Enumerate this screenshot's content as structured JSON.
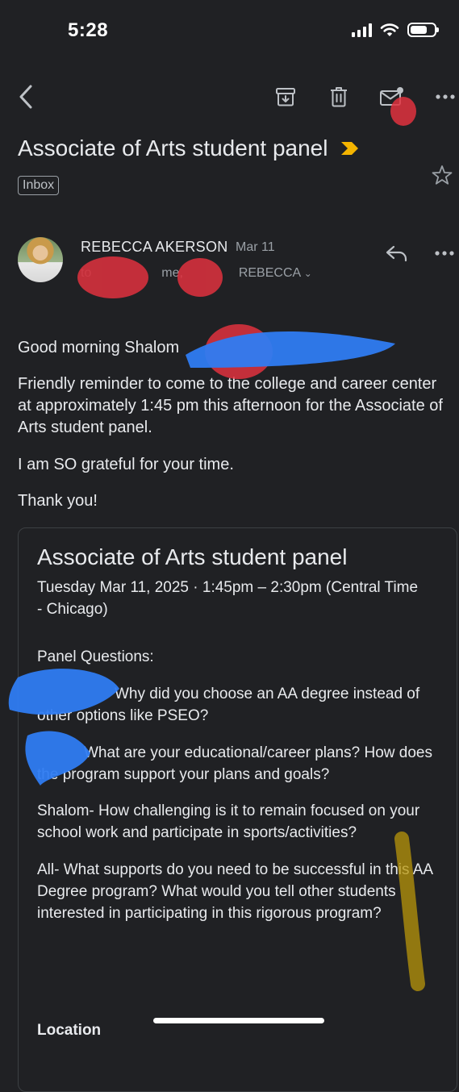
{
  "status_bar": {
    "time": "5:28"
  },
  "toolbar": {
    "back": "back-arrow-icon",
    "archive": "archive-icon",
    "delete": "trash-icon",
    "mark_unread": "mark-unread-icon",
    "more": "more-horizontal-icon"
  },
  "email": {
    "subject": "Associate of Arts student panel",
    "label": "Inbox",
    "importance_color": "#f4b400",
    "sender": "REBECCA AKERSON",
    "date": "Mar 11",
    "recipients_visible": "me,",
    "recipients_tail": "REBECCA",
    "greeting": "Good morning Shalom",
    "paragraphs": [
      "Friendly reminder to come to the college and career center at approximately 1:45 pm this afternoon for the Associate of Arts student panel.",
      "I am SO grateful for your time.",
      "Thank you!"
    ]
  },
  "event_card": {
    "title": "Associate of Arts student panel",
    "when": "Tuesday Mar 11, 2025 · 1:45pm – 2:30pm (Central Time - Chicago)",
    "questions_heading": "Panel Questions:",
    "q1": "Why did you choose an AA degree instead of other options like PSEO?",
    "q2": "What are your educational/career plans? How does the program support your plans and goals?",
    "q3": "Shalom- How challenging is it to remain focused on your school work and participate in sports/activities?",
    "q4": "All- What supports do you need to be successful in this AA Degree program? What would you tell other students interested in participating in this rigorous program?",
    "location_heading": "Location"
  },
  "colors": {
    "background": "#202124",
    "text": "#e8eaed",
    "muted": "#9aa0a6",
    "redaction_red": "#e0313e",
    "redaction_blue": "#2f7cf2",
    "redaction_yellow": "#b8960a"
  }
}
